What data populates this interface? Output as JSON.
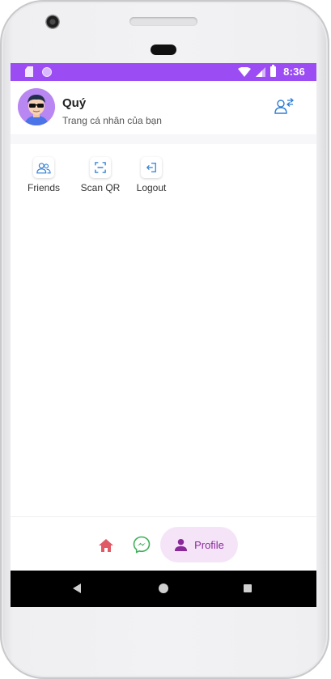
{
  "status_bar": {
    "time": "8:36",
    "icons": [
      "sd-card-icon",
      "notification-dot-icon",
      "wifi-icon",
      "signal-icon",
      "battery-icon"
    ],
    "background_color": "#9b4cf3"
  },
  "profile": {
    "name": "Quý",
    "subtitle": "Trang cá nhân của bạn",
    "avatar_icon": "avatar-sunglasses",
    "switch_icon": "switch-account-icon"
  },
  "actions": [
    {
      "label": "Friends",
      "icon": "friends-icon"
    },
    {
      "label": "Scan QR",
      "icon": "scan-qr-icon"
    },
    {
      "label": "Logout",
      "icon": "logout-icon"
    }
  ],
  "bottom_nav": {
    "items": [
      {
        "icon": "home-icon",
        "active": false
      },
      {
        "icon": "messenger-icon",
        "active": false
      },
      {
        "icon": "person-icon",
        "label": "Profile",
        "active": true
      }
    ],
    "active_bg": "#f5e4f8",
    "active_color": "#8a2a9a"
  },
  "system_nav": [
    "back-icon",
    "home-circle-icon",
    "recents-icon"
  ]
}
